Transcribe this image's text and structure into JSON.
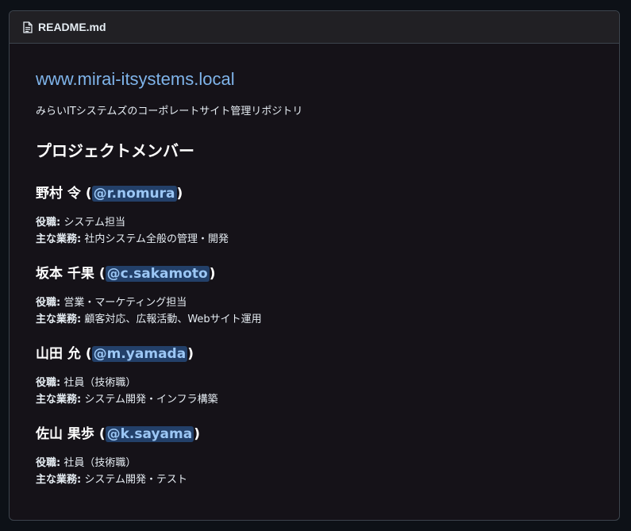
{
  "header": {
    "file_icon": "file-icon",
    "file_name": "README.md"
  },
  "readme": {
    "title": "www.mirai-itsystems.local",
    "description": "みらいITシステムズのコーポレートサイト管理リポジトリ",
    "section_title": "プロジェクトメンバー",
    "role_label": "役職:",
    "duty_label": "主な業務:",
    "members": [
      {
        "name": "野村 令",
        "open_paren": "(",
        "handle": "@r.nomura",
        "close_paren": ")",
        "role": "システム担当",
        "duty": "社内システム全般の管理・開発"
      },
      {
        "name": "坂本 千果",
        "open_paren": "(",
        "handle": "@c.sakamoto",
        "close_paren": ")",
        "role": "営業・マーケティング担当",
        "duty": "顧客対応、広報活動、Webサイト運用"
      },
      {
        "name": "山田 允",
        "open_paren": "(",
        "handle": "@m.yamada",
        "close_paren": ")",
        "role": "社員（技術職）",
        "duty": "システム開発・インフラ構築"
      },
      {
        "name": "佐山 果歩",
        "open_paren": "(",
        "handle": "@k.sayama",
        "close_paren": ")",
        "role": "社員（技術職）",
        "duty": "システム開発・テスト"
      }
    ]
  },
  "colors": {
    "link": "#7fb4ea",
    "mention_bg": "#234069",
    "mention_text": "#9cc7f5"
  }
}
